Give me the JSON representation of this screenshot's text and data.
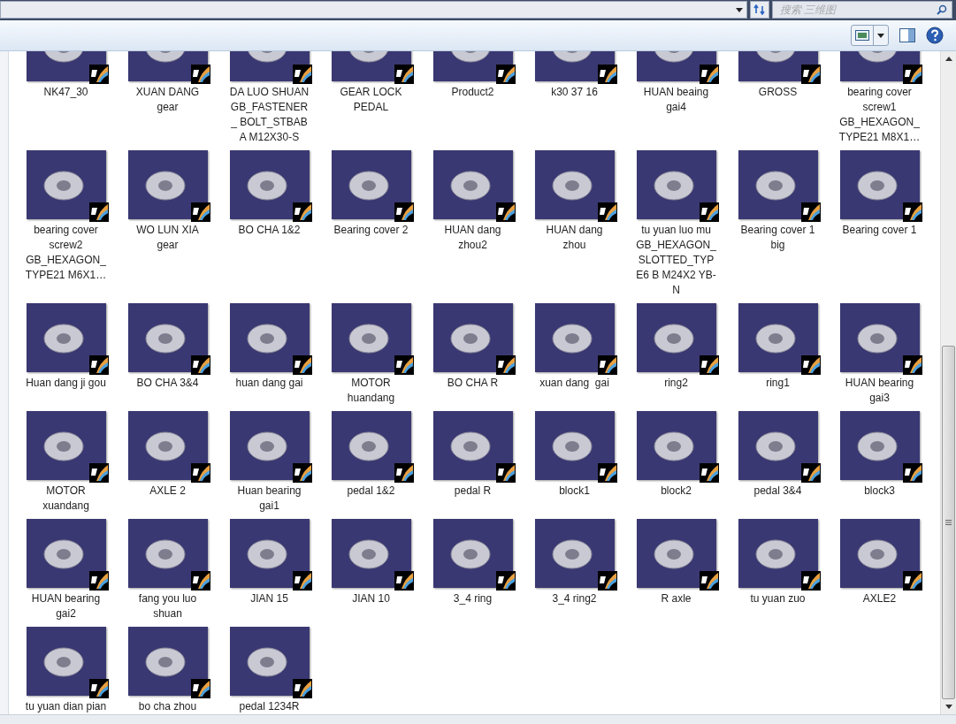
{
  "search": {
    "placeholder": "搜索 三维图"
  },
  "files": [
    {
      "name": "NK47_30"
    },
    {
      "name": "XUAN DANG gear"
    },
    {
      "name": "DA LUO SHUAN GB_FASTENER_ BOLT_STBAB A M12X30-S"
    },
    {
      "name": "GEAR LOCK PEDAL"
    },
    {
      "name": "Product2"
    },
    {
      "name": "k30 37 16"
    },
    {
      "name": "HUAN beaing gai4"
    },
    {
      "name": "GROSS"
    },
    {
      "name": "bearing cover screw1 GB_HEXAGON_ TYPE21 M8X1…"
    },
    {
      "name": "bearing cover screw2 GB_HEXAGON_ TYPE21 M6X1…"
    },
    {
      "name": "WO LUN XIA gear"
    },
    {
      "name": "BO CHA 1&2"
    },
    {
      "name": "Bearing cover 2"
    },
    {
      "name": "HUAN dang zhou2"
    },
    {
      "name": "HUAN dang zhou"
    },
    {
      "name": "tu yuan luo mu GB_HEXAGON_ SLOTTED_TYPE6 B M24X2 YB-N"
    },
    {
      "name": "Bearing cover 1 big"
    },
    {
      "name": "Bearing cover 1"
    },
    {
      "name": "Huan dang ji gou"
    },
    {
      "name": "BO CHA 3&4"
    },
    {
      "name": "huan dang gai"
    },
    {
      "name": "MOTOR huandang"
    },
    {
      "name": "BO CHA R"
    },
    {
      "name": "xuan dang  gai"
    },
    {
      "name": "ring2"
    },
    {
      "name": "ring1"
    },
    {
      "name": "HUAN bearing gai3"
    },
    {
      "name": "MOTOR xuandang"
    },
    {
      "name": "AXLE 2"
    },
    {
      "name": "Huan bearing gai1"
    },
    {
      "name": "pedal 1&2"
    },
    {
      "name": "pedal R"
    },
    {
      "name": "block1"
    },
    {
      "name": "block2"
    },
    {
      "name": "pedal 3&4"
    },
    {
      "name": "block3"
    },
    {
      "name": "HUAN bearing gai2"
    },
    {
      "name": "fang you luo shuan"
    },
    {
      "name": "JIAN 15"
    },
    {
      "name": "JIAN 10"
    },
    {
      "name": "3_4 ring"
    },
    {
      "name": "3_4 ring2"
    },
    {
      "name": "R axle"
    },
    {
      "name": "tu yuan zuo"
    },
    {
      "name": "AXLE2"
    },
    {
      "name": "tu yuan dian pian"
    },
    {
      "name": "bo cha zhou"
    },
    {
      "name": "pedal 1234R"
    }
  ]
}
